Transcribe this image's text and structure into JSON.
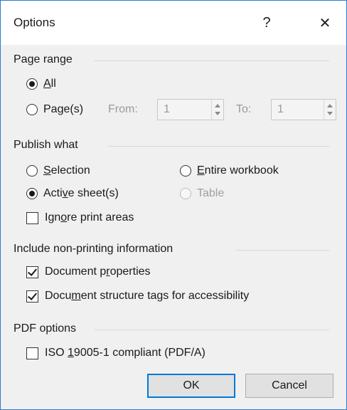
{
  "dialog": {
    "title": "Options",
    "help_label": "?",
    "close_label": "✕"
  },
  "page_range": {
    "title": "Page range",
    "all": {
      "pre": "",
      "ul": "A",
      "post": "ll",
      "selected": true
    },
    "pages": {
      "pre": "Pa",
      "ul": "g",
      "post": "e(s)",
      "selected": false
    },
    "from_label": "From:",
    "from_value": "1",
    "to_label": "To:",
    "to_value": "1"
  },
  "publish_what": {
    "title": "Publish what",
    "selection": {
      "pre": "",
      "ul": "S",
      "post": "election",
      "selected": false
    },
    "entire_workbook": {
      "pre": "",
      "ul": "E",
      "post": "ntire workbook",
      "selected": false
    },
    "active_sheets": {
      "pre": "Acti",
      "ul": "v",
      "post": "e sheet(s)",
      "selected": true
    },
    "table": {
      "label": "Table",
      "disabled": true
    },
    "ignore_print_areas": {
      "pre": "Ign",
      "ul": "o",
      "post": "re print areas",
      "checked": false
    }
  },
  "non_printing": {
    "title": "Include non-printing information",
    "document_properties": {
      "pre": "Document p",
      "ul": "r",
      "post": "operties",
      "checked": true
    },
    "structure_tags": {
      "pre": "Docu",
      "ul": "m",
      "post": "ent structure tags for accessibility",
      "checked": true
    }
  },
  "pdf_options": {
    "title": "PDF options",
    "iso": {
      "pre": "ISO ",
      "ul": "1",
      "post": "9005-1 compliant (PDF/A)",
      "checked": false
    }
  },
  "buttons": {
    "ok": "OK",
    "cancel": "Cancel"
  }
}
